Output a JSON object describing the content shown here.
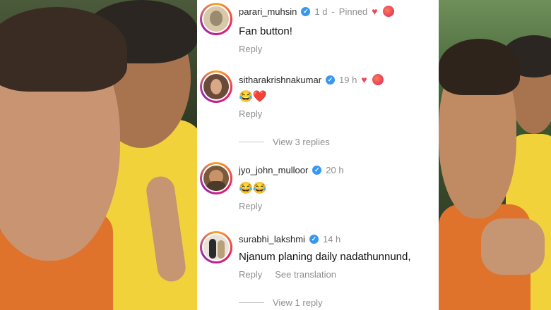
{
  "comments": [
    {
      "username": "parari_muhsin",
      "time": "1 d",
      "pinned_label": "Pinned",
      "body": "Fan button!",
      "reply_label": "Reply",
      "translation_label": ""
    },
    {
      "username": "sitharakrishnakumar",
      "time": "19 h",
      "pinned_label": "",
      "body": "😂❤️",
      "reply_label": "Reply",
      "view_replies_label": "View 3 replies"
    },
    {
      "username": "jyo_john_mulloor",
      "time": "20 h",
      "pinned_label": "",
      "body": "😂😂",
      "reply_label": "Reply"
    },
    {
      "username": "surabhi_lakshmi",
      "time": "14 h",
      "pinned_label": "",
      "body": "Njanum planing daily nadathunnund,",
      "reply_label": "Reply",
      "translation_label": "See translation",
      "view_replies_label": "View 1 reply"
    }
  ],
  "colors": {
    "verified": "#3897f0",
    "heart": "#ed4956",
    "meta": "#8e8e8e"
  },
  "icons": [
    "verified-badge-icon",
    "heart-icon",
    "liked-by-author-avatar"
  ]
}
